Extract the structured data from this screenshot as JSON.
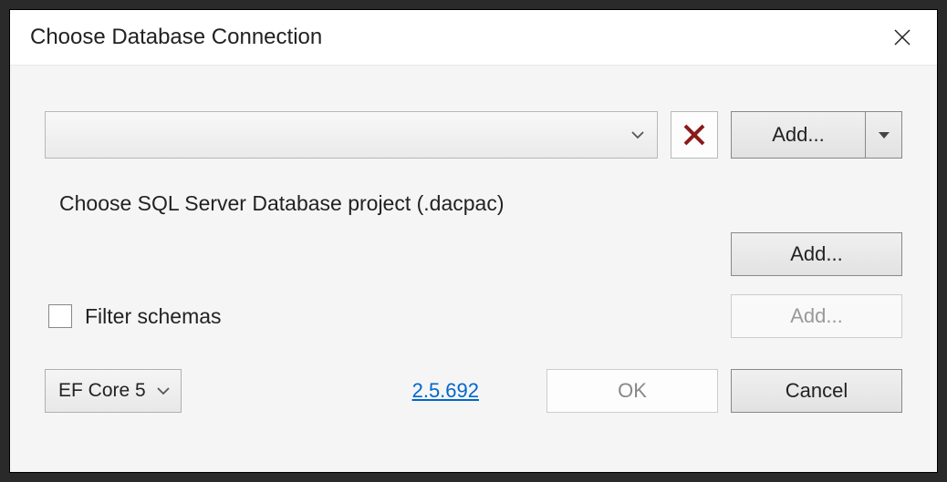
{
  "dialog": {
    "title": "Choose Database Connection"
  },
  "connection": {
    "add_label": "Add..."
  },
  "dacpac": {
    "label": "Choose SQL Server Database project (.dacpac)",
    "add_label": "Add..."
  },
  "filter": {
    "label": "Filter schemas",
    "add_label": "Add..."
  },
  "footer": {
    "ef_version": "EF Core 5",
    "version_link": "2.5.692",
    "ok_label": "OK",
    "cancel_label": "Cancel"
  }
}
